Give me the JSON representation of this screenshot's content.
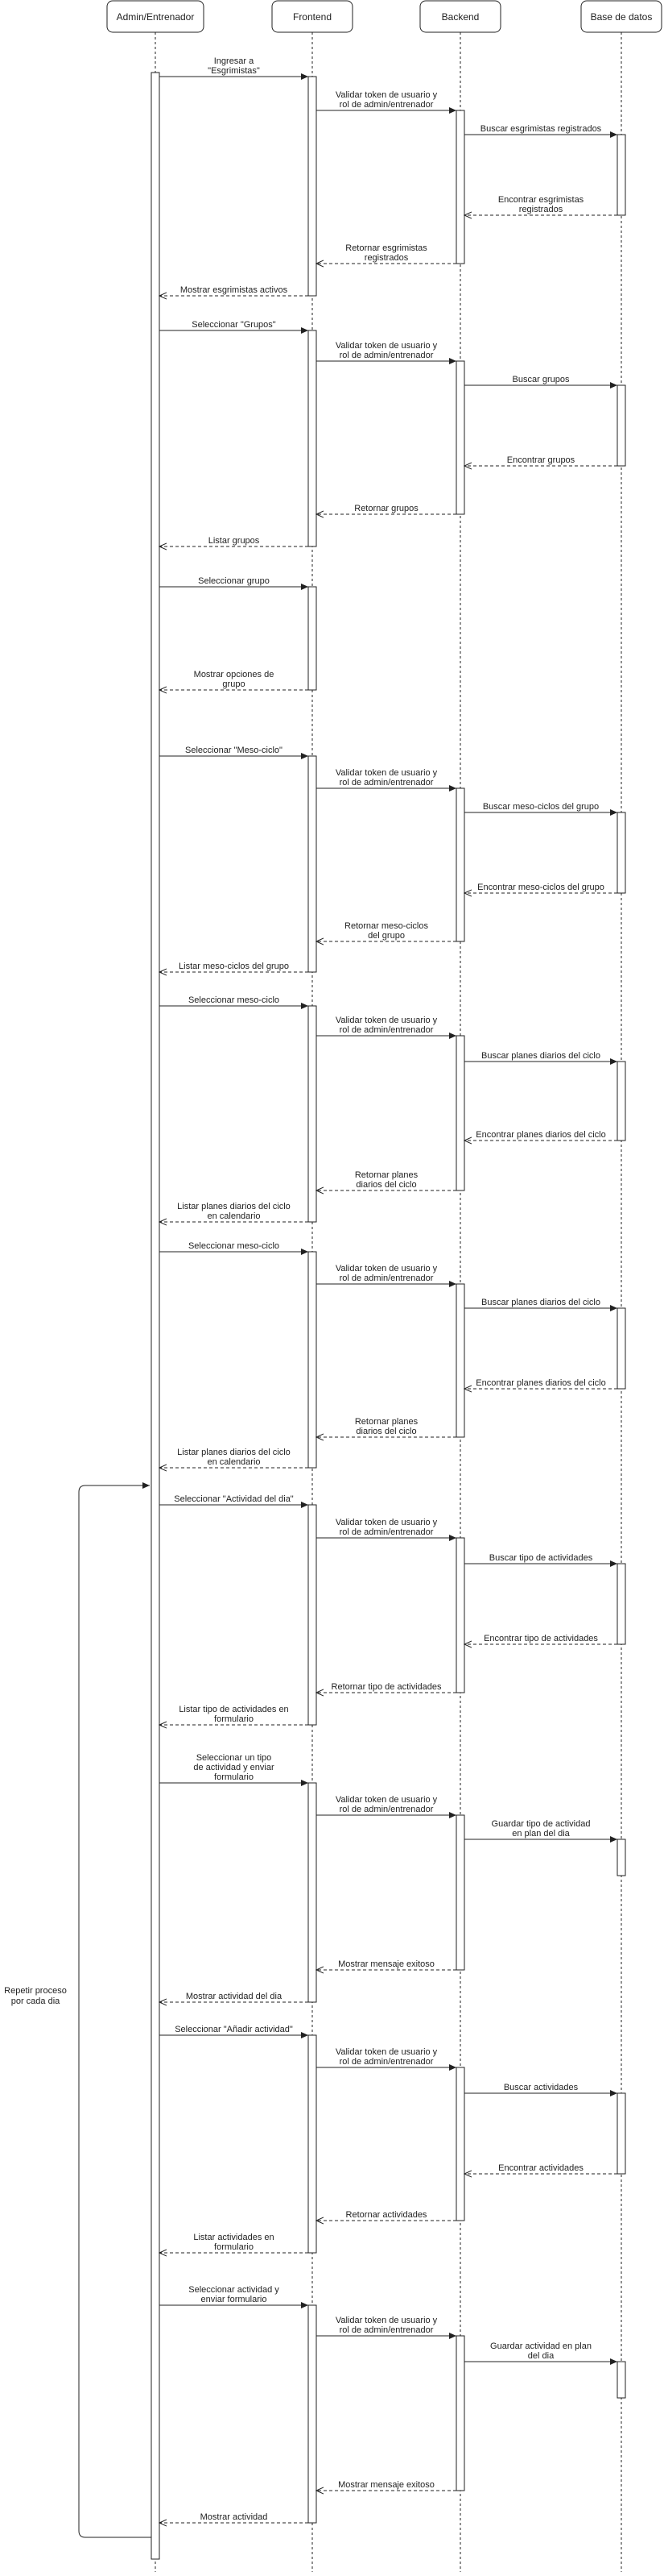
{
  "participants": [
    {
      "id": "admin",
      "name": "Admin/Entrenador"
    },
    {
      "id": "frontend",
      "name": "Frontend"
    },
    {
      "id": "backend",
      "name": "Backend"
    },
    {
      "id": "db",
      "name": "Base de datos"
    }
  ],
  "loop_label": [
    "Repetir proceso",
    "por cada dia"
  ],
  "messages": [
    {
      "from": "admin",
      "to": "frontend",
      "type": "sync",
      "label": [
        "Ingresar a",
        "\"Esgrimistas\""
      ]
    },
    {
      "from": "frontend",
      "to": "backend",
      "type": "sync",
      "label": [
        "Validar token de usuario y",
        "rol de admin/entrenador"
      ]
    },
    {
      "from": "backend",
      "to": "db",
      "type": "sync",
      "label": [
        "Buscar esgrimistas registrados"
      ]
    },
    {
      "from": "db",
      "to": "backend",
      "type": "reply",
      "label": [
        "Encontrar esgrimistas",
        "registrados"
      ]
    },
    {
      "from": "backend",
      "to": "frontend",
      "type": "reply",
      "label": [
        "Retornar esgrimistas",
        "registrados"
      ]
    },
    {
      "from": "frontend",
      "to": "admin",
      "type": "reply",
      "label": [
        "Mostrar esgrimistas activos"
      ]
    },
    {
      "from": "admin",
      "to": "frontend",
      "type": "sync",
      "label": [
        "Seleccionar \"Grupos\""
      ]
    },
    {
      "from": "frontend",
      "to": "backend",
      "type": "sync",
      "label": [
        "Validar token de usuario y",
        "rol de admin/entrenador"
      ]
    },
    {
      "from": "backend",
      "to": "db",
      "type": "sync",
      "label": [
        "Buscar grupos"
      ]
    },
    {
      "from": "db",
      "to": "backend",
      "type": "reply",
      "label": [
        "Encontrar grupos"
      ]
    },
    {
      "from": "backend",
      "to": "frontend",
      "type": "reply",
      "label": [
        "Retornar grupos"
      ]
    },
    {
      "from": "frontend",
      "to": "admin",
      "type": "reply",
      "label": [
        "Listar grupos"
      ]
    },
    {
      "from": "admin",
      "to": "frontend",
      "type": "sync",
      "label": [
        "Seleccionar grupo"
      ]
    },
    {
      "from": "frontend",
      "to": "admin",
      "type": "reply",
      "label": [
        "Mostrar opciones de",
        "grupo"
      ]
    },
    {
      "from": "admin",
      "to": "frontend",
      "type": "sync",
      "label": [
        "Seleccionar \"Meso-ciclo\""
      ]
    },
    {
      "from": "frontend",
      "to": "backend",
      "type": "sync",
      "label": [
        "Validar token de usuario y",
        "rol de admin/entrenador"
      ]
    },
    {
      "from": "backend",
      "to": "db",
      "type": "sync",
      "label": [
        "Buscar meso-ciclos del grupo"
      ]
    },
    {
      "from": "db",
      "to": "backend",
      "type": "reply",
      "label": [
        "Encontrar meso-ciclos del grupo"
      ]
    },
    {
      "from": "backend",
      "to": "frontend",
      "type": "reply",
      "label": [
        "Retornar meso-ciclos",
        "del grupo"
      ]
    },
    {
      "from": "frontend",
      "to": "admin",
      "type": "reply",
      "label": [
        "Listar meso-ciclos del grupo"
      ]
    },
    {
      "from": "admin",
      "to": "frontend",
      "type": "sync",
      "label": [
        "Seleccionar meso-ciclo"
      ]
    },
    {
      "from": "frontend",
      "to": "backend",
      "type": "sync",
      "label": [
        "Validar token de usuario y",
        "rol de admin/entrenador"
      ]
    },
    {
      "from": "backend",
      "to": "db",
      "type": "sync",
      "label": [
        "Buscar planes diarios del ciclo"
      ]
    },
    {
      "from": "db",
      "to": "backend",
      "type": "reply",
      "label": [
        "Encontrar planes diarios del ciclo"
      ]
    },
    {
      "from": "backend",
      "to": "frontend",
      "type": "reply",
      "label": [
        "Retornar planes",
        "diarios del ciclo"
      ]
    },
    {
      "from": "frontend",
      "to": "admin",
      "type": "reply",
      "label": [
        "Listar planes diarios del ciclo",
        "en calendario"
      ]
    },
    {
      "from": "admin",
      "to": "frontend",
      "type": "sync",
      "label": [
        "Seleccionar meso-ciclo"
      ]
    },
    {
      "from": "frontend",
      "to": "backend",
      "type": "sync",
      "label": [
        "Validar token de usuario y",
        "rol de admin/entrenador"
      ]
    },
    {
      "from": "backend",
      "to": "db",
      "type": "sync",
      "label": [
        "Buscar planes diarios del ciclo"
      ]
    },
    {
      "from": "db",
      "to": "backend",
      "type": "reply",
      "label": [
        "Encontrar planes diarios del ciclo"
      ]
    },
    {
      "from": "backend",
      "to": "frontend",
      "type": "reply",
      "label": [
        "Retornar planes",
        "diarios del ciclo"
      ]
    },
    {
      "from": "frontend",
      "to": "admin",
      "type": "reply",
      "label": [
        "Listar planes diarios del ciclo",
        "en calendario"
      ]
    },
    {
      "from": "admin",
      "to": "frontend",
      "type": "sync",
      "label": [
        "Seleccionar \"Actividad del dia\""
      ]
    },
    {
      "from": "frontend",
      "to": "backend",
      "type": "sync",
      "label": [
        "Validar token de usuario y",
        "rol de admin/entrenador"
      ]
    },
    {
      "from": "backend",
      "to": "db",
      "type": "sync",
      "label": [
        "Buscar tipo de actividades"
      ]
    },
    {
      "from": "db",
      "to": "backend",
      "type": "reply",
      "label": [
        "Encontrar tipo de actividades"
      ]
    },
    {
      "from": "backend",
      "to": "frontend",
      "type": "reply",
      "label": [
        "Retornar tipo de actividades"
      ]
    },
    {
      "from": "frontend",
      "to": "admin",
      "type": "reply",
      "label": [
        "Listar tipo de actividades en",
        "formulario"
      ]
    },
    {
      "from": "admin",
      "to": "frontend",
      "type": "sync",
      "label": [
        "Seleccionar un tipo",
        "de actividad y enviar",
        "formulario"
      ]
    },
    {
      "from": "frontend",
      "to": "backend",
      "type": "sync",
      "label": [
        "Validar token de usuario y",
        "rol de admin/entrenador"
      ]
    },
    {
      "from": "backend",
      "to": "db",
      "type": "sync",
      "label": [
        "Guardar tipo de actividad",
        "en plan del dia"
      ]
    },
    {
      "from": "backend",
      "to": "frontend",
      "type": "reply",
      "label": [
        "Mostrar mensaje exitoso"
      ]
    },
    {
      "from": "frontend",
      "to": "admin",
      "type": "reply",
      "label": [
        "Mostrar actividad del dia"
      ]
    },
    {
      "from": "admin",
      "to": "frontend",
      "type": "sync",
      "label": [
        "Seleccionar \"Añadir actividad\""
      ]
    },
    {
      "from": "frontend",
      "to": "backend",
      "type": "sync",
      "label": [
        "Validar token de usuario y",
        "rol de admin/entrenador"
      ]
    },
    {
      "from": "backend",
      "to": "db",
      "type": "sync",
      "label": [
        "Buscar actividades"
      ]
    },
    {
      "from": "db",
      "to": "backend",
      "type": "reply",
      "label": [
        "Encontrar actividades"
      ]
    },
    {
      "from": "backend",
      "to": "frontend",
      "type": "reply",
      "label": [
        "Retornar actividades"
      ]
    },
    {
      "from": "frontend",
      "to": "admin",
      "type": "reply",
      "label": [
        "Listar actividades en",
        "formulario"
      ]
    },
    {
      "from": "admin",
      "to": "frontend",
      "type": "sync",
      "label": [
        "Seleccionar actividad y",
        "enviar formulario"
      ]
    },
    {
      "from": "frontend",
      "to": "backend",
      "type": "sync",
      "label": [
        "Validar token de usuario y",
        "rol de admin/entrenador"
      ]
    },
    {
      "from": "backend",
      "to": "db",
      "type": "sync",
      "label": [
        "Guardar actividad en plan",
        "del dia"
      ]
    },
    {
      "from": "backend",
      "to": "frontend",
      "type": "reply",
      "label": [
        "Mostrar mensaje exitoso"
      ]
    },
    {
      "from": "frontend",
      "to": "admin",
      "type": "reply",
      "label": [
        "Mostrar actividad"
      ]
    }
  ]
}
